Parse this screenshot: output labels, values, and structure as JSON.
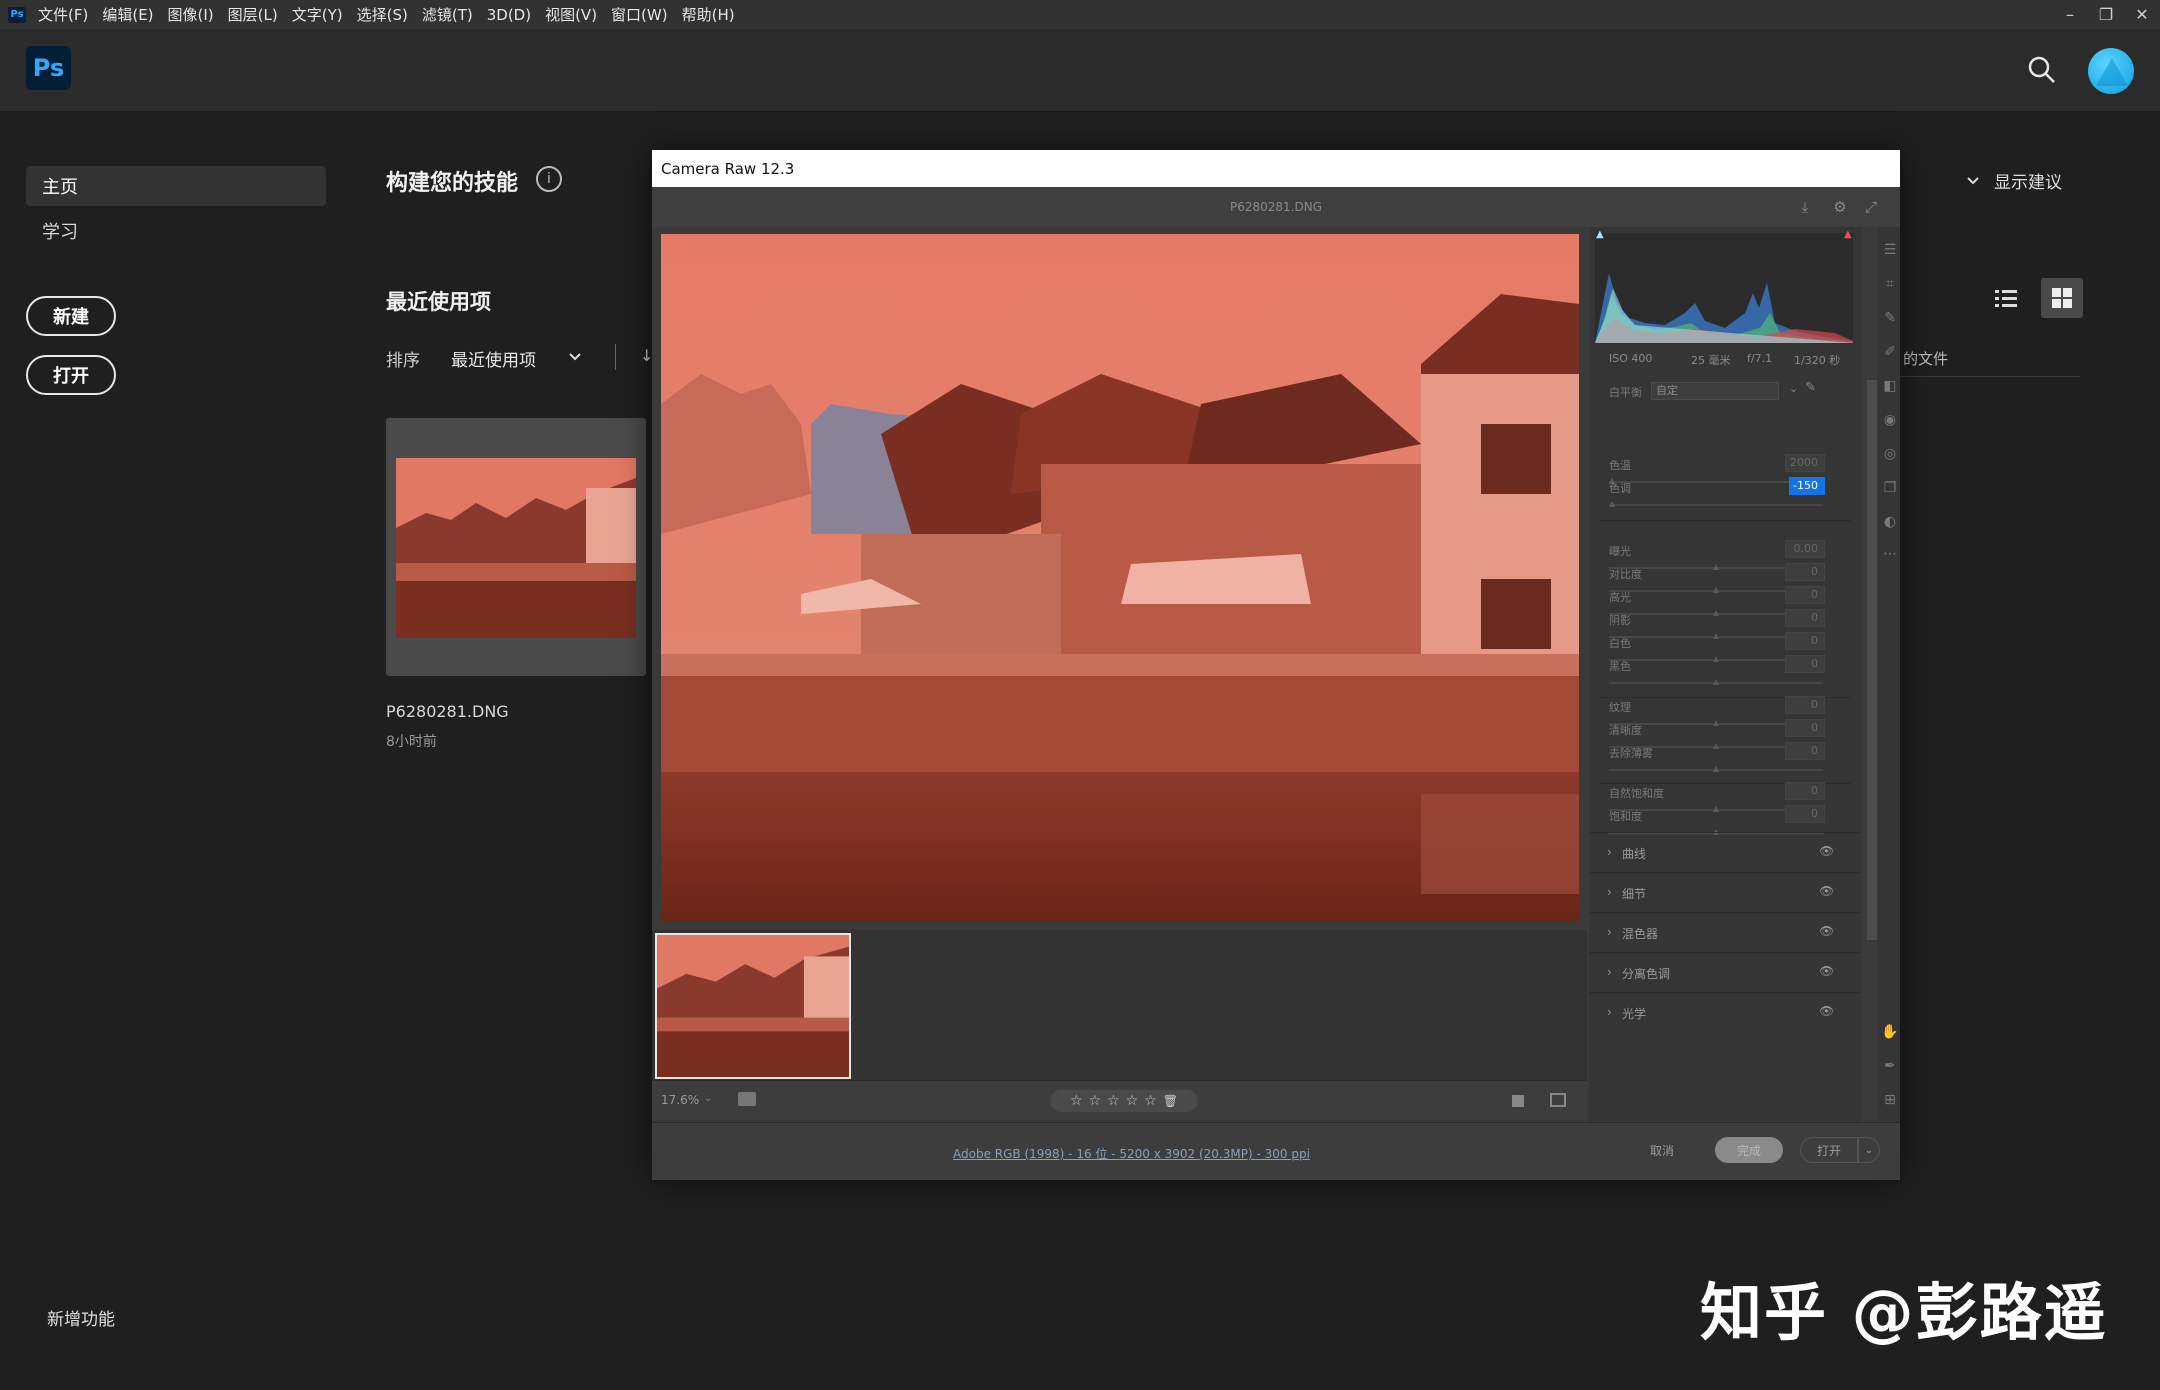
{
  "menubar": {
    "items": [
      "文件(F)",
      "编辑(E)",
      "图像(I)",
      "图层(L)",
      "文字(Y)",
      "选择(S)",
      "滤镜(T)",
      "3D(D)",
      "视图(V)",
      "窗口(W)",
      "帮助(H)"
    ],
    "ps_mini": "Ps"
  },
  "header": {
    "logo": "Ps"
  },
  "sidebar": {
    "home": "主页",
    "learn": "学习",
    "new_button": "新建",
    "open_button": "打开",
    "whats_new": "新增功能"
  },
  "home": {
    "skills_title": "构建您的技能",
    "info": "i",
    "show_suggestions": "显示建议",
    "recent_title": "最近使用项",
    "sort_label": "排序",
    "sort_value": "最近使用项",
    "files_fragment": "的文件",
    "recent_file": {
      "name": "P6280281.DNG",
      "time": "8小时前"
    }
  },
  "dialog": {
    "title": "Camera Raw 12.3",
    "filename": "P6280281.DNG",
    "zoom": "17.6%",
    "meta": {
      "iso": "ISO 400",
      "focal": "25 毫米",
      "aperture": "f/7.1",
      "shutter": "1/320 秒"
    },
    "wb_label": "白平衡",
    "wb_value": "自定",
    "controls": [
      {
        "label": "色温",
        "value": "2000",
        "active": false
      },
      {
        "label": "色调",
        "value": "-150",
        "active": true
      },
      {
        "label": "曝光",
        "value": "0.00",
        "active": false
      },
      {
        "label": "对比度",
        "value": "0",
        "active": false
      },
      {
        "label": "高光",
        "value": "0",
        "active": false
      },
      {
        "label": "阴影",
        "value": "0",
        "active": false
      },
      {
        "label": "白色",
        "value": "0",
        "active": false
      },
      {
        "label": "黑色",
        "value": "0",
        "active": false
      },
      {
        "label": "纹理",
        "value": "0",
        "active": false
      },
      {
        "label": "清晰度",
        "value": "0",
        "active": false
      },
      {
        "label": "去除薄雾",
        "value": "0",
        "active": false
      },
      {
        "label": "自然饱和度",
        "value": "0",
        "active": false
      },
      {
        "label": "饱和度",
        "value": "0",
        "active": false
      }
    ],
    "sections": [
      "曲线",
      "细节",
      "混色器",
      "分离色调",
      "光学"
    ],
    "workflow_link": "Adobe RGB (1998) - 16 位 - 5200 x 3902 (20.3MP) - 300 ppi",
    "cancel": "取消",
    "done": "完成",
    "open": "打开"
  },
  "watermark": "知乎 @彭路遥",
  "colors": {
    "accent": "#1473e6",
    "ps_blue": "#31a8ff",
    "photo_tint": "#e0705c"
  }
}
